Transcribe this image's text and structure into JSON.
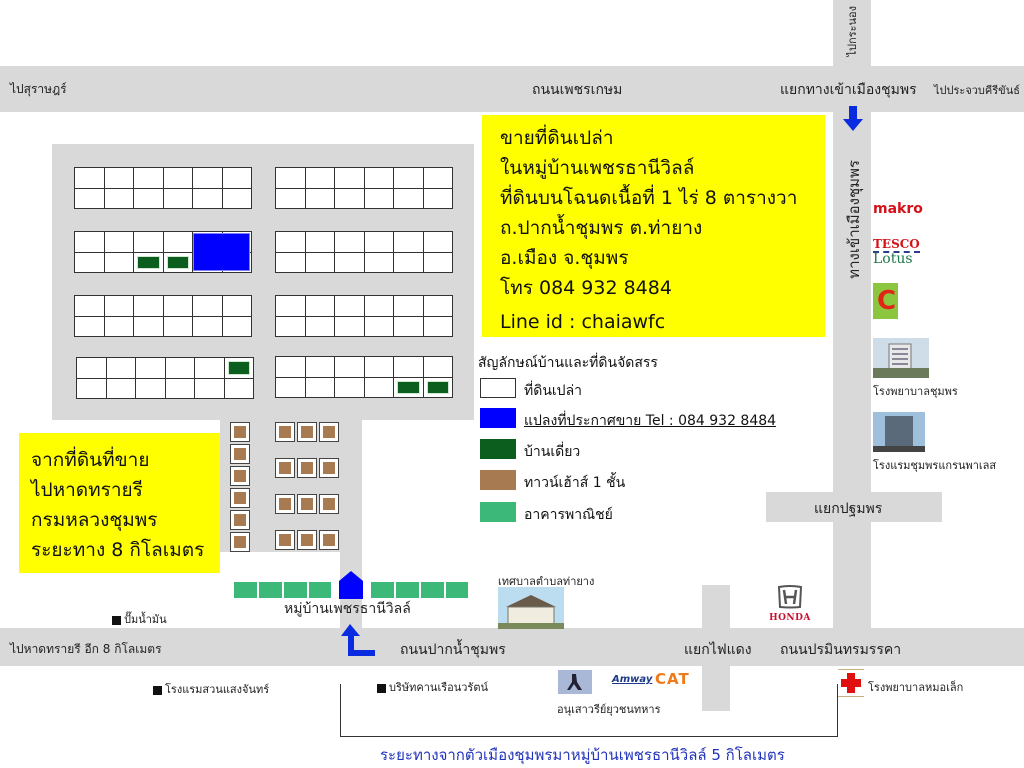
{
  "roads": {
    "top_left_label": "ไปสุราษฎร์",
    "top_main_label": "ถนนเพชรเกษม",
    "top_junction_label": "แยกทางเข้าเมืองชุมพร",
    "top_right_label": "ไปประจวบคีรีขันธ์",
    "north_vertical_label": "ไปกระนอง",
    "east_vertical_label": "ทางเข้าเมืองชุมพร",
    "pathom_junction_label": "แยกปฐมพร",
    "bottom_left_label": "ไปหาดทรายรี อีก 8 กิโลเมตร",
    "bottom_main_label": "ถนนปากน้ำชุมพร",
    "traffic_light_label": "แยกไฟแดง",
    "bottom_right_label": "ถนนปรมินทรมรรคา"
  },
  "sale_info": {
    "lines": [
      "ขายที่ดินเปล่า",
      "ในหมู่บ้านเพชรธานีวิลล์",
      "ที่ดินบนโฉนดเนื้อที่ 1 ไร่ 8 ตารางวา",
      "ถ.ปากน้ำชุมพร ต.ท่ายาง",
      "อ.เมือง จ.ชุมพร",
      "โทร 084 932 8484",
      "Line id : chaiawfc"
    ]
  },
  "beach_info": {
    "lines": [
      "จากที่ดินที่ขาย",
      "ไปหาดทรายรี",
      "กรมหลวงชุมพร",
      "ระยะทาง 8 กิโลเมตร"
    ]
  },
  "legend": {
    "title": "สัญลักษณ์บ้านและที่ดินจัดสรร",
    "items": [
      {
        "label": "ที่ดินเปล่า",
        "color": "#ffffff"
      },
      {
        "label": "แปลงที่ประกาศขาย Tel : 084 932 8484",
        "color": "#0000ff"
      },
      {
        "label": "บ้านเดี่ยว",
        "color": "#0b5e1e"
      },
      {
        "label": "ทาวน์เฮ้าส์ 1 ชั้น",
        "color": "#a87a52"
      },
      {
        "label": "อาคารพาณิชย์",
        "color": "#3cb878"
      }
    ]
  },
  "village": {
    "name": "หมู่บ้านเพชรธานีวิลล์"
  },
  "landmarks": {
    "makro": "makro",
    "tesco_top": "TESCO",
    "tesco_bottom": "Lotus",
    "bigc": "C",
    "chumphon_hospital": "โรงพยาบาลชุมพร",
    "grand_palace_hotel": "โรงแรมชุมพรแกรนพาเลส",
    "tha_yang_municipality": "เทศบาลตำบลท่ายาง",
    "gas_station": "ปั๊มน้ำมัน",
    "suan_saeng_chan_hotel": "โรงแรมสวนแสงจันทร์",
    "ruean_warat_company": "บริษัทคานเรือนวรัตน์",
    "youth_soldier_monument": "อนุเสาวรีย์ยุวชนทหาร",
    "amway": "Amway",
    "cat": "CAT",
    "honda": "HONDA",
    "mor_lek_hospital": "โรงพยาบาลหมอเล็ก"
  },
  "distance_note": "ระยะทางจากตัวเมืองชุมพรมาหมู่บ้านเพชรธานีวิลล์ 5 กิโลเมตร",
  "colors": {
    "road": "#d9d9d9",
    "highlight_yellow": "#ffff00",
    "sale_blue": "#0000ff",
    "arrow_blue": "#0a2be0",
    "distance_text": "#2233bb"
  }
}
